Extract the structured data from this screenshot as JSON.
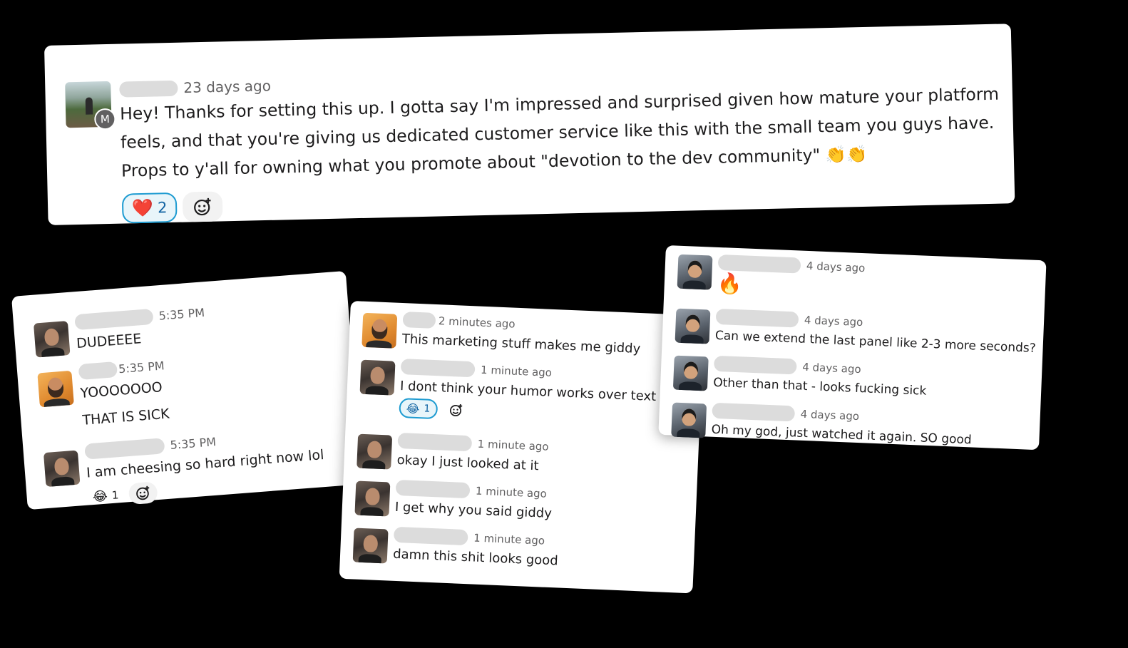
{
  "top_card": {
    "time": "23 days ago",
    "badge": "M",
    "lines": [
      "Hey! Thanks for setting this up. I gotta say I'm impressed and surprised given how mature your platform",
      "feels, and that you're giving us dedicated customer service like this with the small team you guys have.",
      "Props to y'all for owning what you promote about \"devotion to the dev community\" 👏👏"
    ],
    "reaction": {
      "emoji": "❤️",
      "count": "2"
    }
  },
  "left_card": {
    "messages": [
      {
        "time": "5:35 PM",
        "lines": [
          "DUDEEEE"
        ]
      },
      {
        "time": "5:35 PM",
        "lines": [
          "YOOOOOOO",
          "THAT IS SICK"
        ]
      },
      {
        "time": "5:35 PM",
        "lines": [
          "I am cheesing so hard right now lol"
        ],
        "reaction": {
          "emoji": "😂",
          "count": "1"
        }
      }
    ]
  },
  "middle_card": {
    "messages": [
      {
        "time": "2 minutes ago",
        "text": "This marketing stuff makes me giddy"
      },
      {
        "time": "1 minute ago",
        "text": "I dont think your humor works over text",
        "reaction": {
          "emoji": "😂",
          "count": "1"
        }
      },
      {
        "time": "1 minute ago",
        "text": "okay I just looked at it"
      },
      {
        "time": "1 minute ago",
        "text": "I get why you said giddy"
      },
      {
        "time": "1 minute ago",
        "text": "damn this shit looks good"
      }
    ]
  },
  "right_card": {
    "messages": [
      {
        "time": "4 days ago",
        "text": "🔥"
      },
      {
        "time": "4 days ago",
        "text": "Can we extend the last panel like 2-3 more seconds?"
      },
      {
        "time": "4 days ago",
        "text": "Other than that - looks fucking sick"
      },
      {
        "time": "4 days ago",
        "text": "Oh my god, just watched it again. SO good"
      }
    ]
  },
  "colors": {
    "background": "#000000",
    "card": "#ffffff",
    "timestamp": "#616061",
    "reaction_accent": "#1d9bd1",
    "name_redaction": "#dcdcdc"
  },
  "icons": {
    "add_reaction": "add-reaction-icon",
    "heart": "heart-emoji",
    "laugh": "tears-of-joy-emoji",
    "fire": "fire-emoji",
    "clap": "clapping-hands-emoji"
  }
}
